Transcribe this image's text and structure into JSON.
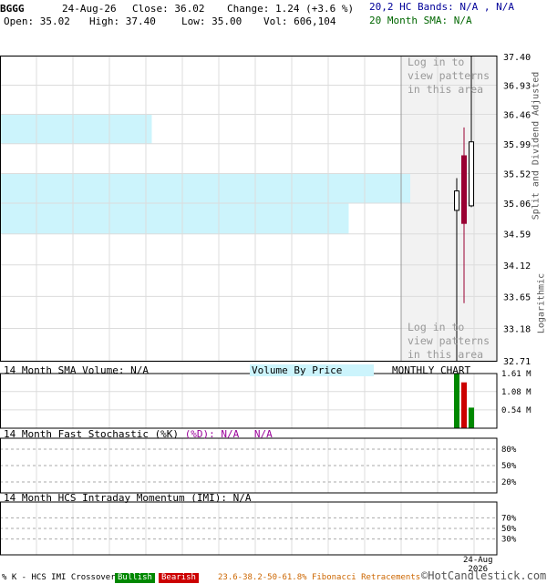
{
  "header": {
    "symbol": "BGGG",
    "date": "24-Aug-26",
    "close": "Close: 36.02",
    "change": "Change: 1.24 (+3.6 %)",
    "open": "Open: 35.02",
    "high": "High: 37.40",
    "low": "Low: 35.00",
    "vol": "Vol: 606,104",
    "hc_bands": "20,2 HC Bands: N/A , N/A",
    "sma20": "20 Month SMA: N/A"
  },
  "side_labels": {
    "adjusted": "Split and Dividend Adjusted",
    "scale": "Logarithmic"
  },
  "overlay": {
    "login_top": [
      "Log in to",
      "view patterns",
      "in this area"
    ],
    "login_bottom": [
      "Log in to",
      "view patterns",
      "in this area"
    ]
  },
  "volume_panel": {
    "title": "14 Month SMA Volume: N/A",
    "vbp": "Volume By Price",
    "chart": "MONTHLY CHART"
  },
  "stoch_panel": {
    "title": "14 Month Fast Stochastic (%K)",
    "d": "(%D): N/A",
    "d_na": "N/A"
  },
  "imi_panel": {
    "title": "14 Month HCS Intraday Momentum (IMI): N/A"
  },
  "footer": {
    "left": "% K - HCS IMI Crossover,",
    "bullish": "Bullish",
    "bearish": "Bearish",
    "fib": "23.6-38.2-50-61.8% Fibonacci Retracements",
    "copyright": "©HotCandlestick.com"
  },
  "date_axis": {
    "month": "24-Aug",
    "year": "2026"
  },
  "colors": {
    "bull": "#008800",
    "bear": "#cc0000",
    "candle_bear": "#990033",
    "vbp": "#ccf4fc",
    "hc": "#000099",
    "sma": "#006600",
    "fib": "#cc6600"
  },
  "chart_data": [
    {
      "type": "candlestick",
      "yscale": "log",
      "ylim": [
        32.71,
        37.4
      ],
      "yticks": [
        "37.40",
        "36.93",
        "36.46",
        "35.99",
        "35.52",
        "35.06",
        "34.59",
        "34.12",
        "33.65",
        "33.18",
        "32.71"
      ],
      "candles": [
        {
          "open": 34.95,
          "high": 35.45,
          "low": 32.71,
          "close": 35.25,
          "dir": "up"
        },
        {
          "open": 35.8,
          "high": 36.25,
          "low": 33.55,
          "close": 34.75,
          "dir": "down"
        },
        {
          "open": 35.02,
          "high": 37.4,
          "low": 35.0,
          "close": 36.02,
          "dir": "up"
        }
      ],
      "volume_by_price": [
        {
          "low": 35.99,
          "high": 36.46,
          "share": 0.37
        },
        {
          "low": 35.06,
          "high": 35.52,
          "share": 1.0
        },
        {
          "low": 34.59,
          "high": 35.06,
          "share": 0.85
        }
      ]
    },
    {
      "type": "bar",
      "title": "14 Month SMA Volume: N/A",
      "yticks": [
        "1.61 M",
        "1.08 M",
        "0.54 M"
      ],
      "ylim": [
        0,
        1.61
      ],
      "values": [
        1.61,
        1.35,
        0.606
      ],
      "colors": [
        "bull",
        "bear",
        "bull"
      ]
    },
    {
      "type": "line",
      "title": "14 Month Fast Stochastic (%K)",
      "yticks": [
        "80%",
        "50%",
        "20%"
      ],
      "values": []
    },
    {
      "type": "line",
      "title": "14 Month HCS Intraday Momentum (IMI): N/A",
      "yticks": [
        "70%",
        "50%",
        "30%"
      ],
      "values": []
    }
  ]
}
